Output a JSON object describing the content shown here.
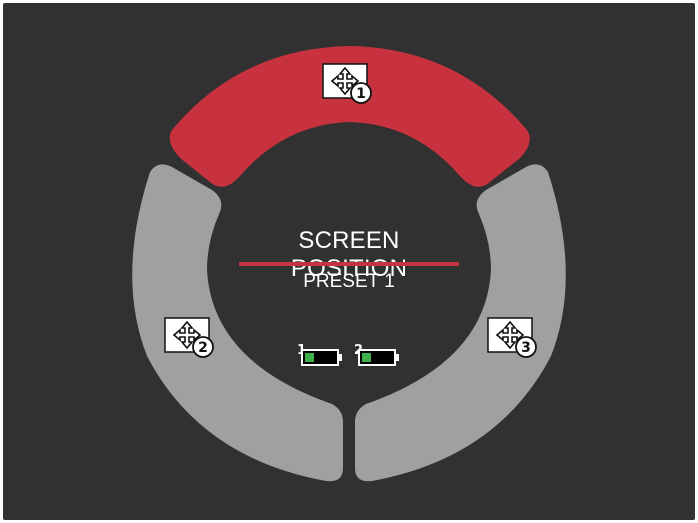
{
  "center": {
    "title": "SCREEN POSITION",
    "subtitle": "PRESET 1"
  },
  "segments": [
    {
      "id": 1,
      "icon": "move-arrows-icon",
      "badge": "1",
      "state": "selected",
      "color": "#c7323e"
    },
    {
      "id": 2,
      "icon": "move-arrows-icon",
      "badge": "2",
      "state": "unselected",
      "color": "#9fa09f"
    },
    {
      "id": 3,
      "icon": "move-arrows-icon",
      "badge": "3",
      "state": "unselected",
      "color": "#9fa09f"
    }
  ],
  "batteries": [
    {
      "label": "1",
      "level": 0.3,
      "color": "#3fb04b"
    },
    {
      "label": "2",
      "level": 0.3,
      "color": "#3fb04b"
    }
  ],
  "colors": {
    "background": "#313131",
    "accent": "#c7323e",
    "segment_inactive": "#9fa09f"
  }
}
